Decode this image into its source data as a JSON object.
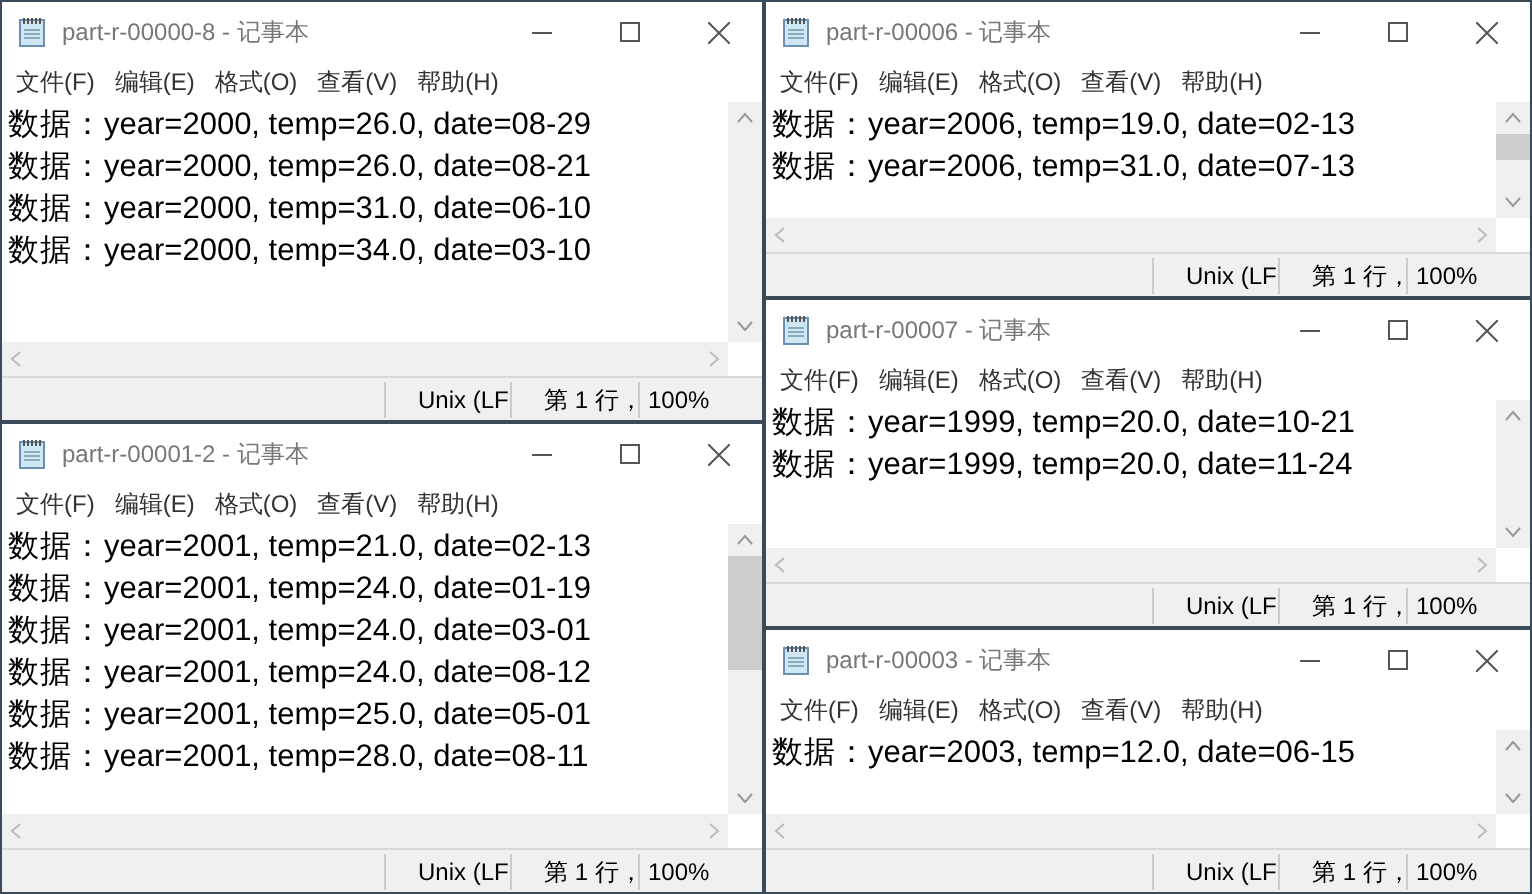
{
  "columns": [
    {
      "windows": [
        {
          "title": "part-r-00000-8 - 记事本",
          "menu": [
            "文件(F)",
            "编辑(E)",
            "格式(O)",
            "查看(V)",
            "帮助(H)"
          ],
          "lines": [
            "数据：year=2000, temp=26.0, date=08-29",
            "数据：year=2000, temp=26.0, date=08-21",
            "数据：year=2000, temp=31.0, date=06-10",
            "数据：year=2000, temp=34.0, date=03-10"
          ],
          "scroll_thumb": false,
          "status": [
            "Unix (LF",
            "第 1 行，",
            "100%"
          ]
        },
        {
          "title": "part-r-00001-2 - 记事本",
          "menu": [
            "文件(F)",
            "编辑(E)",
            "格式(O)",
            "查看(V)",
            "帮助(H)"
          ],
          "lines": [
            "数据：year=2001, temp=21.0, date=02-13",
            "数据：year=2001, temp=24.0, date=01-19",
            "数据：year=2001, temp=24.0, date=03-01",
            "数据：year=2001, temp=24.0, date=08-12",
            "数据：year=2001, temp=25.0, date=05-01",
            "数据：year=2001, temp=28.0, date=08-11"
          ],
          "scroll_thumb": true,
          "status": [
            "Unix (LF",
            "第 1 行，",
            "100%"
          ]
        }
      ]
    },
    {
      "windows": [
        {
          "title": "part-r-00006 - 记事本",
          "menu": [
            "文件(F)",
            "编辑(E)",
            "格式(O)",
            "查看(V)",
            "帮助(H)"
          ],
          "lines": [
            "数据：year=2006, temp=19.0, date=02-13",
            "数据：year=2006, temp=31.0, date=07-13"
          ],
          "scroll_thumb": true,
          "status": [
            "Unix (LF",
            "第 1 行，",
            "100%"
          ]
        },
        {
          "title": "part-r-00007 - 记事本",
          "menu": [
            "文件(F)",
            "编辑(E)",
            "格式(O)",
            "查看(V)",
            "帮助(H)"
          ],
          "lines": [
            "数据：year=1999, temp=20.0, date=10-21",
            "数据：year=1999, temp=20.0, date=11-24"
          ],
          "scroll_thumb": false,
          "status": [
            "Unix (LF",
            "第 1 行，",
            "100%"
          ]
        },
        {
          "title": "part-r-00003 - 记事本",
          "menu": [
            "文件(F)",
            "编辑(E)",
            "格式(O)",
            "查看(V)",
            "帮助(H)"
          ],
          "lines": [
            "数据：year=2003, temp=12.0, date=06-15"
          ],
          "scroll_thumb": false,
          "status": [
            "Unix (LF",
            "第 1 行，",
            "100%"
          ]
        }
      ]
    }
  ]
}
